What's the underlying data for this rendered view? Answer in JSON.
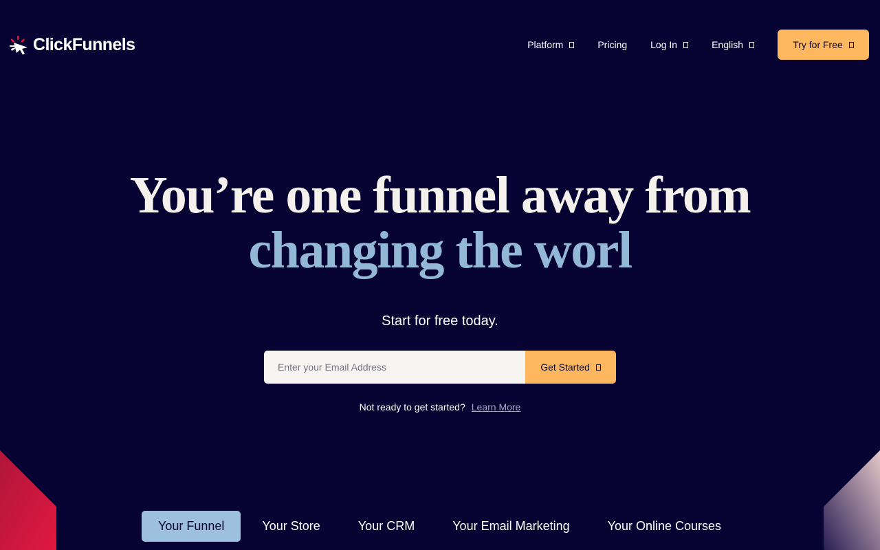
{
  "brand": {
    "name": "ClickFunnels",
    "logo_icon": "clickfunnels-cursor-icon",
    "accent_color": "#fdb85f",
    "background_color": "#070433",
    "highlight_color": "#93b8d6"
  },
  "nav": {
    "items": [
      {
        "label": "Platform",
        "has_caret": true
      },
      {
        "label": "Pricing",
        "has_caret": false
      },
      {
        "label": "Log In",
        "has_caret": true
      },
      {
        "label": "English",
        "has_caret": true
      }
    ],
    "cta_label": "Try for Free"
  },
  "hero": {
    "title_line1": "You’re one funnel away from",
    "title_line2": "changing the worl",
    "subtitle": "Start for free today.",
    "email_placeholder": "Enter your Email Address",
    "email_value": "",
    "submit_label": "Get Started",
    "not_ready_text": "Not ready to get started?",
    "learn_more_label": "Learn More"
  },
  "tabs": {
    "active_index": 0,
    "items": [
      "Your Funnel",
      "Your Store",
      "Your CRM",
      "Your Email Marketing",
      "Your Online Courses"
    ]
  }
}
